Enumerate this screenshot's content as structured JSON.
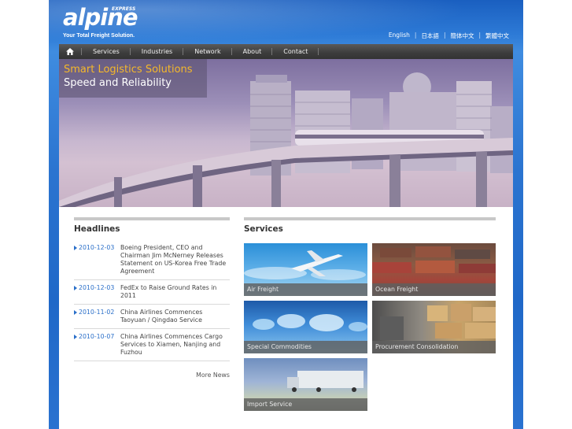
{
  "brand": {
    "logo": "alpine",
    "logo_badge": "EXPRESS",
    "tagline": "Your Total Freight Solution."
  },
  "languages": [
    "English",
    "日本語",
    "簡体中文",
    "繁體中文"
  ],
  "nav": {
    "home_icon": "home-icon",
    "items": [
      "Services",
      "Industries",
      "Network",
      "About",
      "Contact"
    ]
  },
  "hero": {
    "title": "Smart Logistics Solutions",
    "subtitle": "Speed and Reliability"
  },
  "headlines": {
    "heading": "Headlines",
    "items": [
      {
        "date": "2010-12-03",
        "text": "Boeing President, CEO and Chairman Jim McNerney Releases Statement on US-Korea Free Trade Agreement"
      },
      {
        "date": "2010-12-03",
        "text": "FedEx to Raise Ground Rates in 2011"
      },
      {
        "date": "2010-11-02",
        "text": "China Airlines Commences Taoyuan / Qingdao Service"
      },
      {
        "date": "2010-10-07",
        "text": "China Airlines Commences Cargo Services to Xiamen, Nanjing and Fuzhou"
      }
    ],
    "more": "More News"
  },
  "services": {
    "heading": "Services",
    "items": [
      {
        "label": "Air Freight"
      },
      {
        "label": "Ocean Freight"
      },
      {
        "label": "Special Commodities"
      },
      {
        "label": "Procurement Consolidation"
      },
      {
        "label": "Import Service"
      }
    ]
  },
  "colors": {
    "background_blue": "#2b74d0",
    "nav_dark": "#3e3e3e",
    "accent_orange": "#f5b82a",
    "link_blue": "#2a6fc9"
  }
}
